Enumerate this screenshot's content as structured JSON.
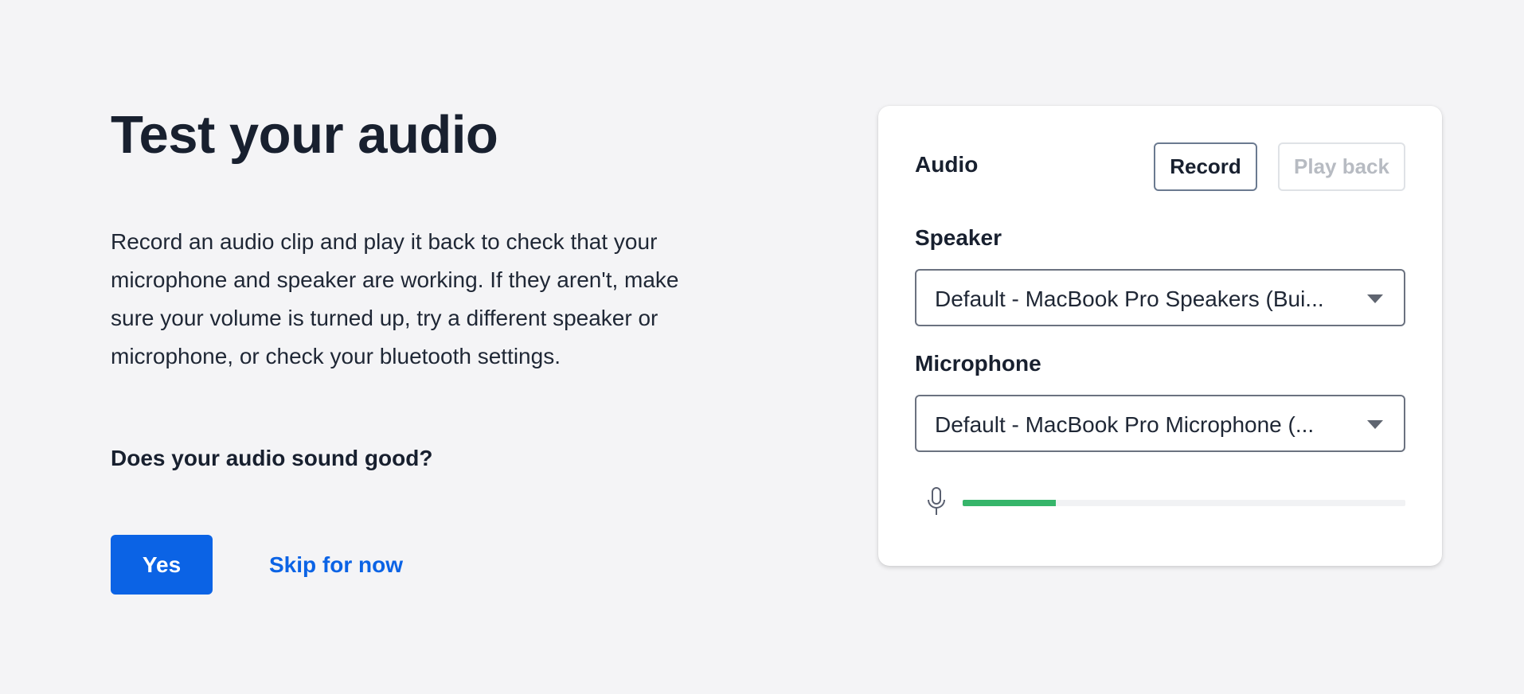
{
  "page": {
    "title": "Test your audio",
    "description": "Record an audio clip and play it back to check that your microphone and speaker are working. If they aren't, make sure your volume is turned up, try a different speaker or microphone, or check your bluetooth settings.",
    "question": "Does your audio sound good?",
    "yes_label": "Yes",
    "skip_label": "Skip for now"
  },
  "audio_card": {
    "title": "Audio",
    "record_label": "Record",
    "playback_label": "Play back",
    "speaker": {
      "label": "Speaker",
      "value": "Default - MacBook Pro Speakers (Bui..."
    },
    "microphone": {
      "label": "Microphone",
      "value": "Default - MacBook Pro Microphone (..."
    },
    "mic_level": 0.21,
    "mic_icon": "microphone-icon",
    "dropdown_icon": "caret-down-icon"
  },
  "colors": {
    "background": "#f4f4f6",
    "primary": "#0b63e5",
    "text": "#18202f",
    "meter_fill": "#36b56a",
    "disabled_text": "#b7bbc2"
  }
}
